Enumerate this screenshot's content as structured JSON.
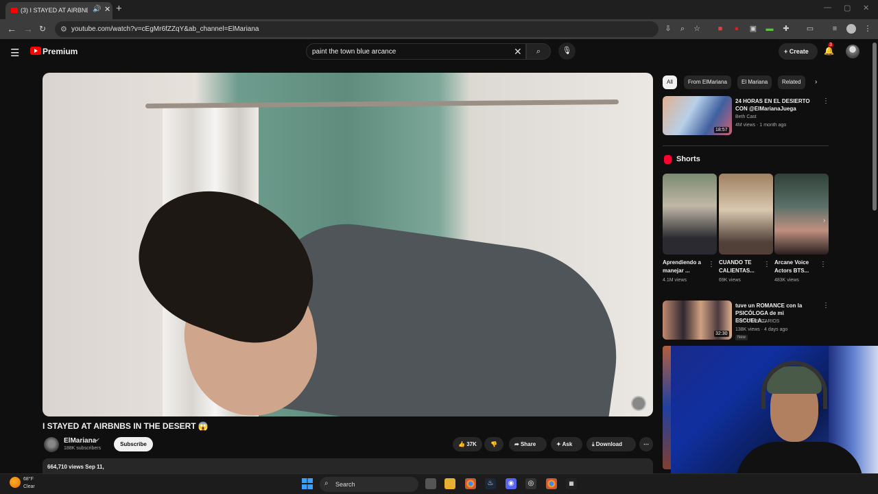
{
  "browser": {
    "tab_title": "(3) I STAYED AT AIRBNBS IN",
    "url": "youtube.com/watch?v=cEgMr6fZZqY&ab_channel=ElMariana"
  },
  "header": {
    "brand": "Premium",
    "search_query": "paint the town blue arcance",
    "create_label": "Create",
    "notification_count": "3"
  },
  "video": {
    "title": "I STAYED AT AIRBNBS IN THE DESERT 😱",
    "channel": "ElMariana",
    "subscribers": "188K subscribers",
    "subscribe_label": "Subscribe",
    "likes": "37K",
    "share_label": "Share",
    "ask_label": "Ask",
    "download_label": "Download",
    "views_date": "664,710 views  Sep 11,"
  },
  "sidebar": {
    "chips": [
      "All",
      "From ElMariana",
      "El Mariana",
      "Related"
    ],
    "rec1": {
      "title": "24 HORAS EN EL DESIERTO CON @ElMarianaJuega",
      "channel": "Beth Cast",
      "stats": "4M views · 1 month ago",
      "duration": "18:57"
    },
    "shorts_label": "Shorts",
    "shorts": [
      {
        "title": "Aprendiendo a manejar ...",
        "views": "4.1M views"
      },
      {
        "title": "CUANDO TE CALIENTAS...",
        "views": "69K views"
      },
      {
        "title": "Arcane Voice Actors BTS...",
        "views": "483K views"
      }
    ],
    "rec2": {
      "title": "tuve un ROMANCE con la PSICÓLOGA de mi ESCUELA...",
      "channel": "5INCO MENTARIOS",
      "stats": "138K views · 4 days ago",
      "duration": "32:30",
      "badge": "New"
    }
  },
  "taskbar": {
    "temp": "68°F",
    "weather": "Clear",
    "search_label": "Search"
  }
}
